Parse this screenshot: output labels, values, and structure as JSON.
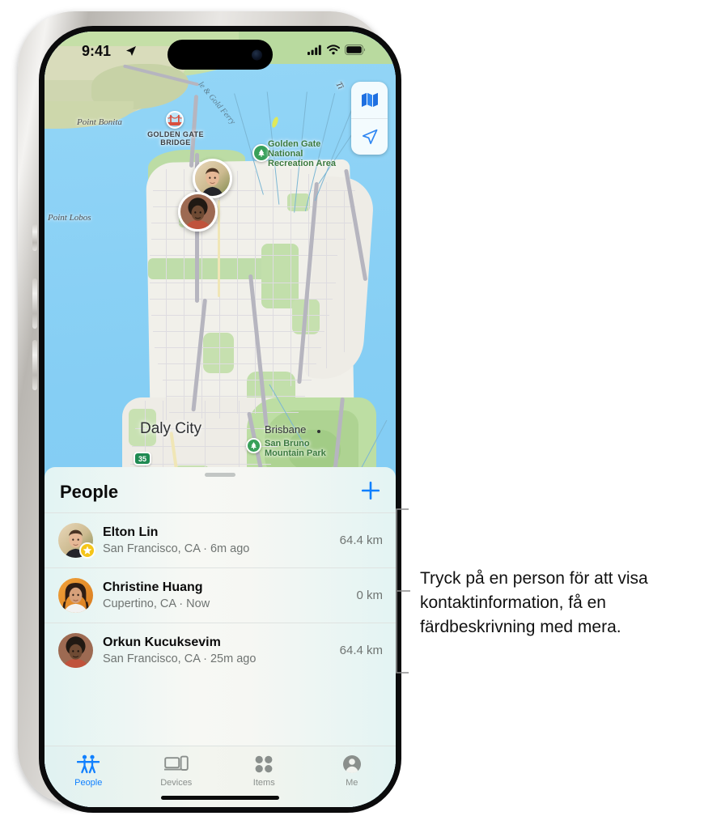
{
  "status_bar": {
    "time": "9:41",
    "location_icon": "location-arrow-icon",
    "cellular_icon": "cellular-bars-icon",
    "wifi_icon": "wifi-icon",
    "battery_icon": "battery-icon"
  },
  "map": {
    "controls": [
      {
        "name": "map-type-button",
        "icon": "folded-map-icon"
      },
      {
        "name": "locate-me-button",
        "icon": "location-arrow-icon"
      }
    ],
    "labels": [
      {
        "text": "Point Bonita",
        "type": "place"
      },
      {
        "text": "Point Lobos",
        "type": "place"
      },
      {
        "text": "GOLDEN GATE BRIDGE",
        "type": "bridge"
      },
      {
        "text": "Golden Gate National Recreation Area",
        "type": "park"
      },
      {
        "text": "Daly City",
        "type": "city"
      },
      {
        "text": "Brisbane",
        "type": "city-small"
      },
      {
        "text": "San Bruno Mountain Park",
        "type": "park"
      },
      {
        "text": "le & Gold Ferry",
        "type": "ferry-route"
      },
      {
        "text": "Ti",
        "type": "place-clipped"
      }
    ],
    "bridge_label_line1": "GOLDEN GATE",
    "bridge_label_line2": "BRIDGE",
    "gg_park_line1": "Golden Gate",
    "gg_park_line2": "National",
    "gg_park_line3": "Recreation Area",
    "sb_park_line1": "San Bruno",
    "sb_park_line2": "Mountain Park",
    "ferry_label": "le & Gold Ferry",
    "tiburon_clip": "Ti",
    "highway_shield": "35",
    "avatar_pins": [
      {
        "name": "map-pin-elton-lin"
      },
      {
        "name": "map-pin-orkun-kucuksevim"
      }
    ]
  },
  "sheet": {
    "title": "People",
    "add_label": "+",
    "people": [
      {
        "name": "Elton Lin",
        "subtitle": "San Francisco, CA · 6m ago",
        "distance": "64.4 km",
        "badge": "star-badge"
      },
      {
        "name": "Christine Huang",
        "subtitle": "Cupertino, CA · Now",
        "distance": "0 km",
        "badge": ""
      },
      {
        "name": "Orkun Kucuksevim",
        "subtitle": "San Francisco, CA · 25m ago",
        "distance": "64.4 km",
        "badge": ""
      }
    ]
  },
  "tab_bar": {
    "tabs": [
      {
        "label": "People",
        "icon": "people-icon",
        "active": true
      },
      {
        "label": "Devices",
        "icon": "devices-icon",
        "active": false
      },
      {
        "label": "Items",
        "icon": "items-grid-icon",
        "active": false
      },
      {
        "label": "Me",
        "icon": "person-circle-icon",
        "active": false
      }
    ]
  },
  "callout": {
    "text": "Tryck på en person för att visa kontaktinformation, få en färdbeskrivning med mera."
  },
  "colors": {
    "accent_blue": "#1080ff",
    "water": "#8ad2f6",
    "land": "#f0efe9",
    "park_green": "#bddea3",
    "star_yellow": "#f5c518"
  }
}
